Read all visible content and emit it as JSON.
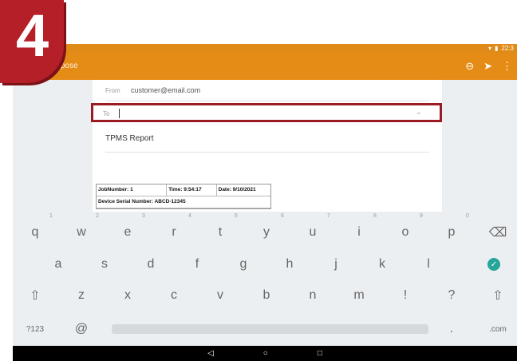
{
  "step_number": "4",
  "status_time": "22:3",
  "appbar": {
    "title": "pose",
    "actions": [
      "attach-icon",
      "send-icon",
      "more-icon"
    ]
  },
  "compose": {
    "from_label": "From",
    "from_value": "customer@email.com",
    "to_label": "To",
    "subject": "TPMS Report"
  },
  "report": {
    "row1": [
      "JobNumber: 1",
      "Time: 9:54:17",
      "Date: 9/10/2021"
    ],
    "row2": "Device Serial Number: ABCD-12345"
  },
  "keyboard": {
    "row1": [
      "q",
      "w",
      "e",
      "r",
      "t",
      "y",
      "u",
      "i",
      "o",
      "p"
    ],
    "row1_hints": [
      "1",
      "2",
      "3",
      "4",
      "5",
      "6",
      "7",
      "8",
      "9",
      "0"
    ],
    "row2": [
      "a",
      "s",
      "d",
      "f",
      "g",
      "h",
      "j",
      "k",
      "l"
    ],
    "row3": [
      "z",
      "x",
      "c",
      "v",
      "b",
      "n",
      "m",
      "!",
      "?"
    ],
    "symbols_key": "?123",
    "at_key": "@",
    "period_key": ".",
    "dotcom_key": ".com"
  },
  "colors": {
    "accent": "#e58c17",
    "badge": "#b51f27",
    "highlight": "#9b1b24",
    "enter": "#26a69a"
  }
}
